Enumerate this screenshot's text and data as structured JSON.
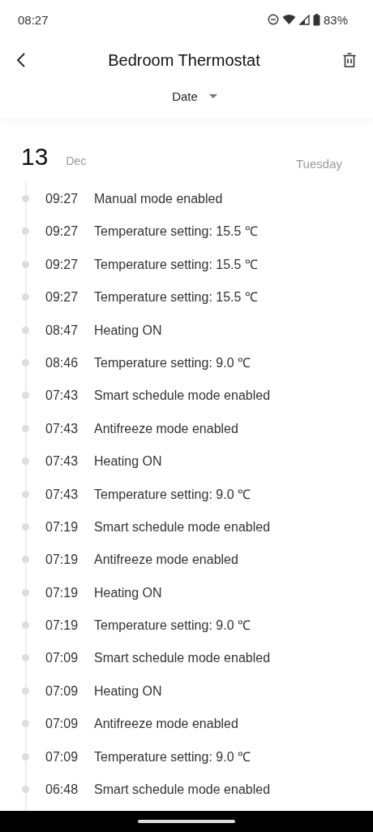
{
  "status_bar": {
    "time": "08:27",
    "battery": "83%"
  },
  "header": {
    "title": "Bedroom Thermostat"
  },
  "filter": {
    "label": "Date"
  },
  "day": {
    "day": "13",
    "month": "Dec",
    "weekday": "Tuesday"
  },
  "events": [
    {
      "time": "09:27",
      "text": "Manual mode enabled"
    },
    {
      "time": "09:27",
      "text": "Temperature setting: 15.5 ℃"
    },
    {
      "time": "09:27",
      "text": "Temperature setting: 15.5 ℃"
    },
    {
      "time": "09:27",
      "text": "Temperature setting: 15.5 ℃"
    },
    {
      "time": "08:47",
      "text": "Heating ON"
    },
    {
      "time": "08:46",
      "text": "Temperature setting: 9.0 ℃"
    },
    {
      "time": "07:43",
      "text": "Smart schedule mode enabled"
    },
    {
      "time": "07:43",
      "text": "Antifreeze mode enabled"
    },
    {
      "time": "07:43",
      "text": "Heating ON"
    },
    {
      "time": "07:43",
      "text": "Temperature setting: 9.0 ℃"
    },
    {
      "time": "07:19",
      "text": "Smart schedule mode enabled"
    },
    {
      "time": "07:19",
      "text": "Antifreeze mode enabled"
    },
    {
      "time": "07:19",
      "text": "Heating ON"
    },
    {
      "time": "07:19",
      "text": "Temperature setting: 9.0 ℃"
    },
    {
      "time": "07:09",
      "text": "Smart schedule mode enabled"
    },
    {
      "time": "07:09",
      "text": "Heating ON"
    },
    {
      "time": "07:09",
      "text": "Antifreeze mode enabled"
    },
    {
      "time": "07:09",
      "text": "Temperature setting: 9.0 ℃"
    },
    {
      "time": "06:48",
      "text": "Smart schedule mode enabled"
    }
  ]
}
